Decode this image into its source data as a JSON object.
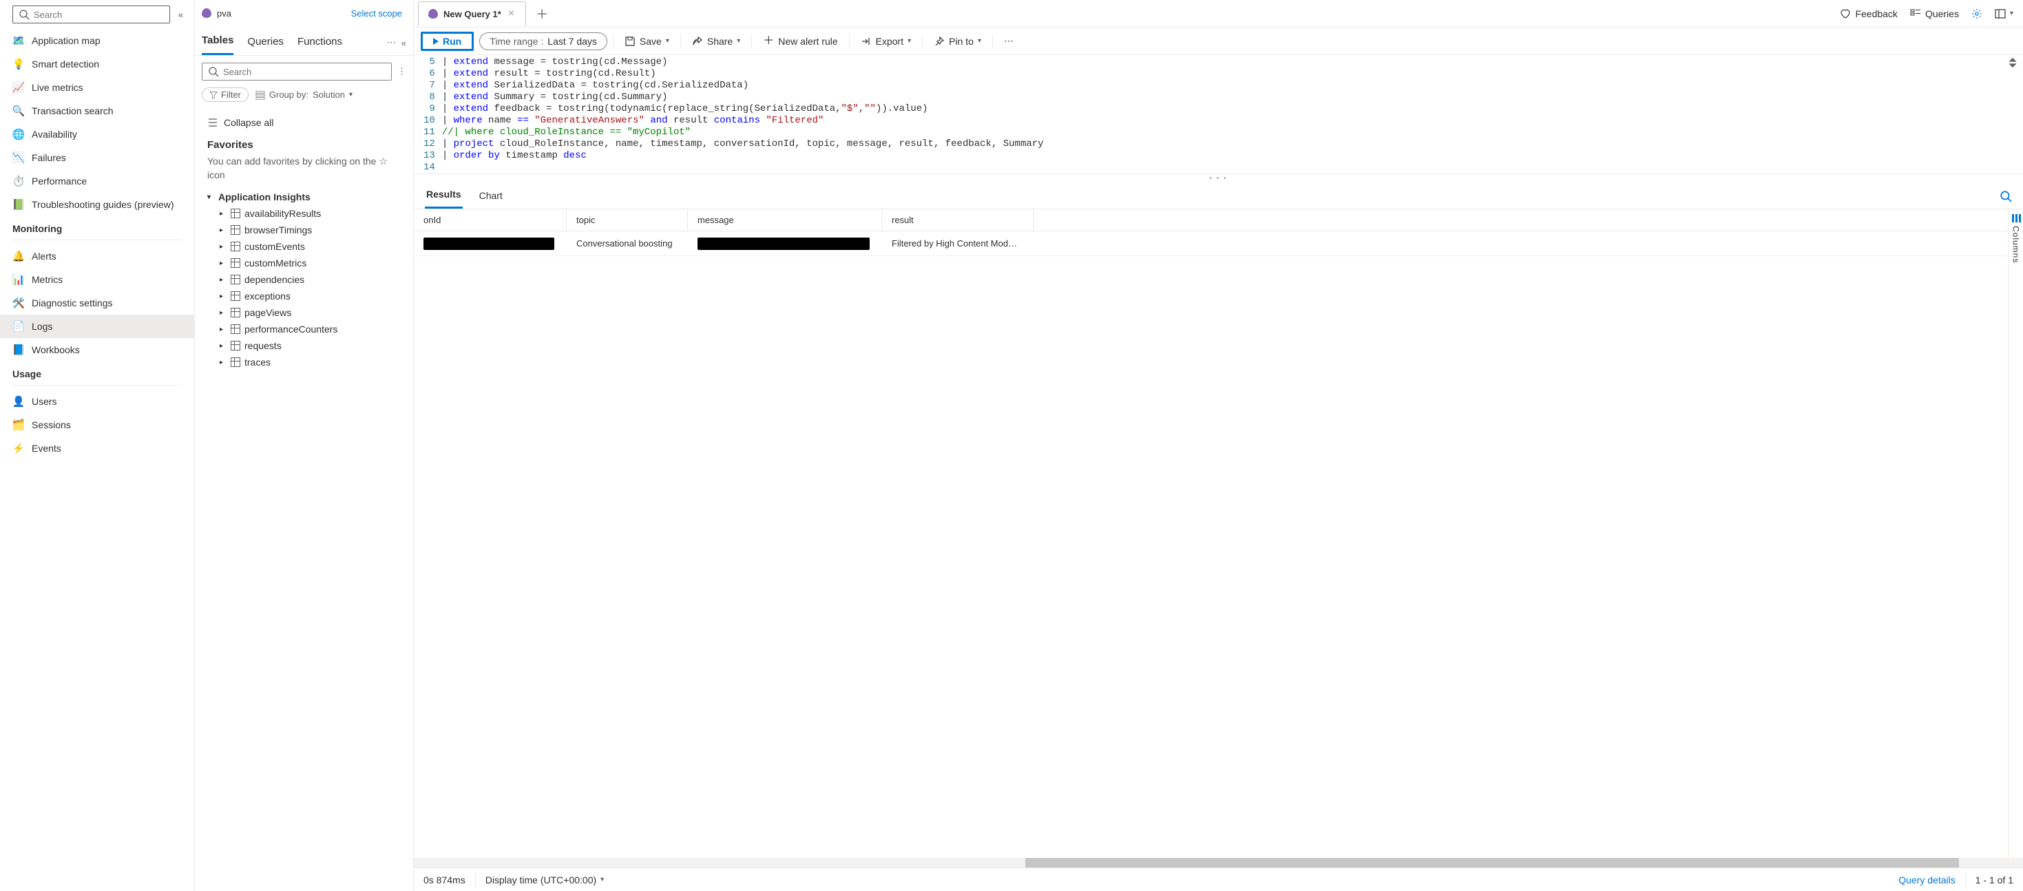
{
  "sidebar": {
    "search_placeholder": "Search",
    "nav": [
      {
        "label": "Application map",
        "icon": "🗺️"
      },
      {
        "label": "Smart detection",
        "icon": "💡"
      },
      {
        "label": "Live metrics",
        "icon": "📈"
      },
      {
        "label": "Transaction search",
        "icon": "🔍"
      },
      {
        "label": "Availability",
        "icon": "🌐"
      },
      {
        "label": "Failures",
        "icon": "📉"
      },
      {
        "label": "Performance",
        "icon": "⏱️"
      },
      {
        "label": "Troubleshooting guides (preview)",
        "icon": "📗"
      }
    ],
    "sections": [
      {
        "title": "Monitoring",
        "items": [
          {
            "label": "Alerts",
            "icon": "🔔"
          },
          {
            "label": "Metrics",
            "icon": "📊"
          },
          {
            "label": "Diagnostic settings",
            "icon": "🛠️"
          },
          {
            "label": "Logs",
            "icon": "📄",
            "active": true
          },
          {
            "label": "Workbooks",
            "icon": "📘"
          }
        ]
      },
      {
        "title": "Usage",
        "items": [
          {
            "label": "Users",
            "icon": "👤"
          },
          {
            "label": "Sessions",
            "icon": "🗂️"
          },
          {
            "label": "Events",
            "icon": "⚡"
          }
        ]
      }
    ]
  },
  "tabs": {
    "active_label": "New Query 1*"
  },
  "top_right": {
    "feedback": "Feedback",
    "queries": "Queries"
  },
  "scope": {
    "name": "pva",
    "select_scope": "Select scope"
  },
  "toolbar": {
    "run": "Run",
    "time_label": "Time range :",
    "time_value": "Last 7 days",
    "save": "Save",
    "share": "Share",
    "new_alert": "New alert rule",
    "export": "Export",
    "pin": "Pin to"
  },
  "schema": {
    "tabs": {
      "tables": "Tables",
      "queries": "Queries",
      "functions": "Functions"
    },
    "search_placeholder": "Search",
    "filter_label": "Filter",
    "groupby_label": "Group by:",
    "groupby_value": "Solution",
    "collapse_all": "Collapse all",
    "favorites_title": "Favorites",
    "favorites_desc": "You can add favorites by clicking on the ☆ icon",
    "root_label": "Application Insights",
    "tables_list": [
      "availabilityResults",
      "browserTimings",
      "customEvents",
      "customMetrics",
      "dependencies",
      "exceptions",
      "pageViews",
      "performanceCounters",
      "requests",
      "traces"
    ]
  },
  "editor": {
    "first_line_no": 5,
    "lines": [
      {
        "t": "| extend message = tostring(cd.Message)"
      },
      {
        "t": "| extend result = tostring(cd.Result)"
      },
      {
        "t": "| extend SerializedData = tostring(cd.SerializedData)"
      },
      {
        "t": "| extend Summary = tostring(cd.Summary)"
      },
      {
        "t": "| extend feedback = tostring(todynamic(replace_string(SerializedData,\"$\",\"\")).value)"
      },
      {
        "t": "| where name == \"GenerativeAnswers\" and result contains \"Filtered\""
      },
      {
        "t": "//| where cloud_RoleInstance == \"myCopilot\"",
        "comment": true
      },
      {
        "t": "| project cloud_RoleInstance, name, timestamp, conversationId, topic, message, result, feedback, Summary"
      },
      {
        "t": "| order by timestamp desc"
      },
      {
        "t": ""
      }
    ]
  },
  "results": {
    "tabs": {
      "results": "Results",
      "chart": "Chart"
    },
    "columns_rail": "Columns",
    "headers": [
      "onId",
      "topic",
      "message",
      "result"
    ],
    "rows": [
      {
        "onId": "████████████",
        "topic": "Conversational boosting",
        "message": "████████████████",
        "result": "Filtered by High Content Mod…"
      }
    ]
  },
  "status": {
    "duration": "0s 874ms",
    "display_time": "Display time (UTC+00:00)",
    "query_details": "Query details",
    "paging": "1 - 1 of 1"
  }
}
